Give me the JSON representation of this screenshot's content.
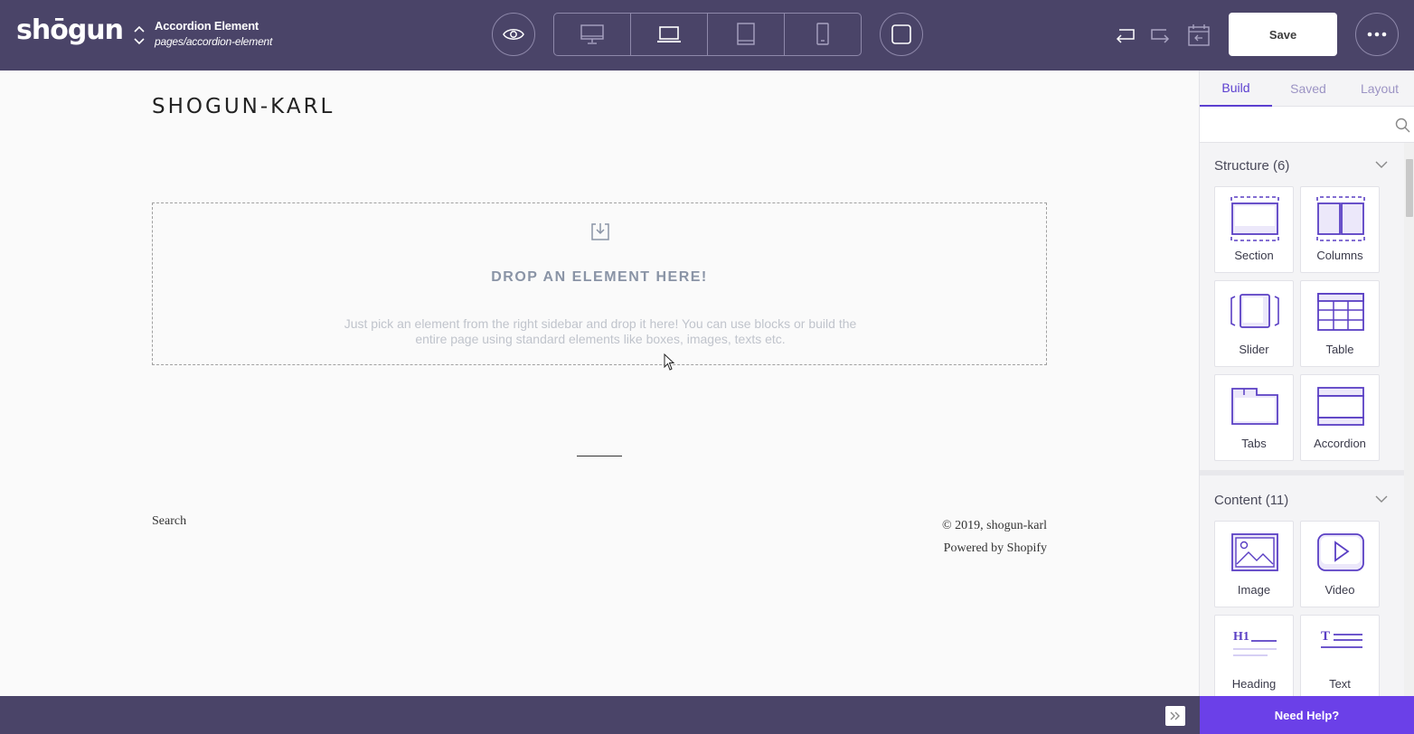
{
  "app": {
    "logo": "shōgun"
  },
  "page": {
    "title": "Accordion Element",
    "path": "pages/accordion-element"
  },
  "toolbar": {
    "save_label": "Save",
    "devices": [
      "desktop-icon",
      "laptop-icon",
      "tablet-icon",
      "mobile-icon"
    ],
    "active_device": "laptop-icon"
  },
  "canvas": {
    "store_name": "SHOGUN-KARL",
    "drop_title": "DROP AN ELEMENT HERE!",
    "drop_desc": "Just pick an element from the right sidebar and drop it here! You can use blocks or build the entire page using standard elements like boxes, images, texts etc.",
    "footer_search": "Search",
    "footer_copyright": "© 2019, shogun-karl",
    "footer_powered": "Powered by Shopify"
  },
  "sidebar": {
    "tabs": [
      "Build",
      "Saved",
      "Layout"
    ],
    "active_tab": "Build",
    "search_placeholder": "",
    "structure": {
      "title": "Structure (6)",
      "items": [
        "Section",
        "Columns",
        "Slider",
        "Table",
        "Tabs",
        "Accordion"
      ]
    },
    "content": {
      "title": "Content (11)",
      "items": [
        "Image",
        "Video",
        "Heading",
        "Text"
      ]
    }
  },
  "bottom": {
    "help_label": "Need Help?"
  },
  "colors": {
    "topbar": "#4a4468",
    "accent": "#5b3fd0",
    "help": "#6b40e8"
  }
}
